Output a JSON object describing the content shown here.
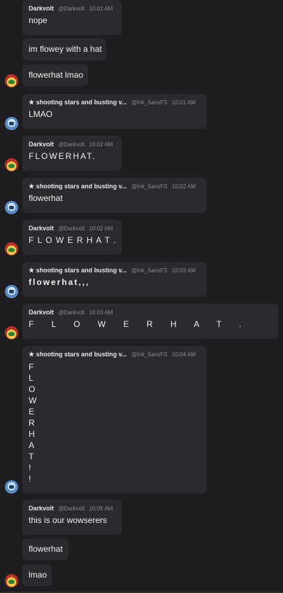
{
  "messages": [
    {
      "author": "Darkvolt",
      "handle": "@Darkvolt",
      "time": "10:01 AM",
      "text": "nope"
    },
    {
      "text": "im flowey with a hat"
    },
    {
      "text": "flowerhat lmao"
    },
    {
      "author": "★ shooting stars and busting v...",
      "handle": "@Ink_SansFS",
      "time": "10:01 AM",
      "text": "LMAO"
    },
    {
      "author": "Darkvolt",
      "handle": "@Darkvolt",
      "time": "10:02 AM",
      "text": "FLOWERHAT."
    },
    {
      "author": "★ shooting stars and busting v...",
      "handle": "@Ink_SansFS",
      "time": "10:02 AM",
      "text": "flowerhat"
    },
    {
      "author": "Darkvolt",
      "handle": "@Darkvolt",
      "time": "10:02 AM",
      "text": "F L O W E R H A T ."
    },
    {
      "author": "★ shooting stars and busting v...",
      "handle": "@Ink_SansFS",
      "time": "10:03 AM",
      "text": "flowerhat,,,"
    },
    {
      "author": "Darkvolt",
      "handle": "@Darkvolt",
      "time": "10:03 AM",
      "text": "F L O W E R H A T ."
    },
    {
      "author": "★ shooting stars and busting v...",
      "handle": "@Ink_SansFS",
      "time": "10:04 AM",
      "lines": [
        "F",
        "L",
        "O",
        "W",
        "E",
        "R",
        "H",
        "A",
        "T",
        "!",
        "!"
      ]
    },
    {
      "author": "Darkvolt",
      "handle": "@Darkvolt",
      "time": "10:05 AM",
      "text": "this is our wowserers"
    },
    {
      "text": "flowerhat"
    },
    {
      "text": "lmao"
    }
  ],
  "avatars": {
    "flowey": "flowey-avatar",
    "sans": "ink-sans-avatar"
  }
}
